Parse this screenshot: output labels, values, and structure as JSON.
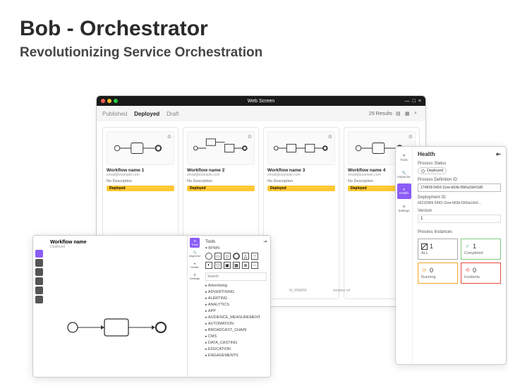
{
  "hero": {
    "title": "Bob - Orchestrator",
    "subtitle": "Revolutionizing Service Orchestration"
  },
  "browser": {
    "title": "Web Screen",
    "tabs": [
      "Published",
      "Deployed",
      "Draft"
    ],
    "active_tab": "Deployed",
    "results": "29 Results",
    "right_rail": [
      "IDE",
      "Filter"
    ],
    "cards": [
      {
        "name": "Workflow name 1",
        "email": "email@example.com",
        "desc": "No Description",
        "status": "Deployed"
      },
      {
        "name": "Workflow name 2",
        "email": "email@example.com",
        "desc": "No Description",
        "status": "Deployed"
      },
      {
        "name": "Workflow name 3",
        "email": "email@example.com",
        "desc": "No Description",
        "status": "Deployed"
      },
      {
        "name": "Workflow name 4",
        "email": "email@example.com",
        "desc": "No Description",
        "status": "Deployed"
      }
    ]
  },
  "editor": {
    "workflow_name": "Workflow name",
    "workflow_sub": "Deployed",
    "tools_title": "Tools",
    "section_bpmn": "BPMN",
    "search_placeholder": "Search",
    "categories": [
      "Advertising",
      "ADVERTISING",
      "ALERTING",
      "ANALYTICS",
      "APP",
      "AUDIENCE_MEASUREMENT",
      "AUTOMATION",
      "BROADCAST_CHAIN",
      "CMS",
      "DATA_CASTING",
      "EDUCATION",
      "ENGAGEMENTS"
    ],
    "rail_items": [
      "Tools",
      "Inspector",
      "Health",
      "Settings"
    ]
  },
  "bg_labels": {
    "a": "M_WMATA",
    "b": "weather wf"
  },
  "health": {
    "title": "Health",
    "rail": [
      "Tools",
      "Inspector",
      "Health",
      "Settings"
    ],
    "status_label": "Process Status",
    "status_value": "Deployed",
    "def_label": "Process Definition ID",
    "def_value": "174818-5493-11ee-b63b-f2b5a10e01d0",
    "dep_label": "Deployment ID",
    "dep_value": "b5232966-5493-11ee-b63b-f2b5a10e0…",
    "version_label": "Version",
    "version_value": "1",
    "instances_label": "Process Instances",
    "instances": {
      "all": {
        "count": "1",
        "label": "ALL"
      },
      "completed": {
        "count": "1",
        "label": "Completed"
      },
      "running": {
        "count": "0",
        "label": "Running"
      },
      "incidents": {
        "count": "0",
        "label": "Incidents"
      }
    }
  }
}
